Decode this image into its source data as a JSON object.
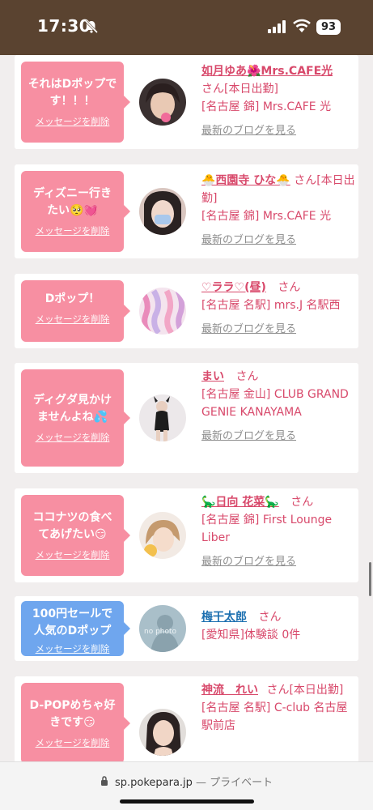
{
  "status_bar": {
    "time": "17:30",
    "battery": "93"
  },
  "delete_label": "メッセージを削除",
  "blog_label": "最新のブログを見る",
  "san": "さん",
  "cards": [
    {
      "message": "それはDポップです！！！",
      "name": "如月ゆあ🌺Mrs.CAFE光",
      "suffix": "さん[本日出勤]",
      "shop": "[名古屋 錦] Mrs.CAFE 光",
      "blog": true
    },
    {
      "message": "ディズニー行きたい🥺💓",
      "name": "🐣西園寺 ひな🐣",
      "suffix": "さん[本日出勤]",
      "shop": "[名古屋 錦] Mrs.CAFE 光",
      "blog": true
    },
    {
      "message": "Dポップ！",
      "name": "♡ララ♡(昼)",
      "suffix": "さん",
      "shop": "[名古屋 名駅] mrs.J 名駅西",
      "blog": true
    },
    {
      "message": "ディグダ見かけませんよね💦",
      "name": "まい",
      "suffix": "さん",
      "shop": "[名古屋 金山] CLUB GRAND GENIE KANAYAMA",
      "blog": true
    },
    {
      "message": "ココナツの食べてあげたい😏",
      "name": "🦕日向 花菜🦕",
      "suffix": "さん",
      "shop": "[名古屋 錦] First Lounge Liber",
      "blog": true
    },
    {
      "message": "100円セールで人気のDポップ",
      "name": "梅干太郎",
      "suffix": "さん",
      "shop": "[愛知県]体験談 0件",
      "blog": false,
      "avatar_text": "no photo"
    },
    {
      "message": "D-POPめちゃ好きです😏",
      "name": "神流　れい",
      "suffix": "さん[本日出勤]",
      "shop": "[名古屋 名駅] C-club 名古屋駅前店",
      "blog": false
    }
  ],
  "url_bar": {
    "url": "sp.pokepara.jp",
    "mode": "— プライベート"
  },
  "colors": {
    "accent_pink": "#f78fa2",
    "accent_blue": "#6fa6ee",
    "name_pink": "#d8496b",
    "status_brown": "#5a4330"
  }
}
